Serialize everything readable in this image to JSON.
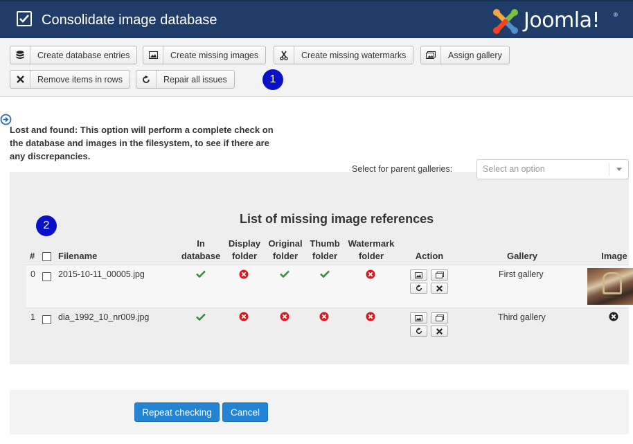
{
  "header": {
    "title": "Consolidate image database",
    "logo_text": "Joomla!"
  },
  "toolbar": {
    "buttons": [
      {
        "label": "Create database entries",
        "icon": "database-icon"
      },
      {
        "label": "Create missing images",
        "icon": "image-icon"
      },
      {
        "label": "Create missing watermarks",
        "icon": "scissors-icon"
      },
      {
        "label": "Assign gallery",
        "icon": "gallery-icon"
      },
      {
        "label": "Remove items in rows",
        "icon": "close-icon"
      },
      {
        "label": "Repair all issues",
        "icon": "refresh-icon"
      }
    ],
    "marker": "1"
  },
  "info": {
    "text": "Lost and found: This option will perform a complete check on the database and images in the filesystem, to see if there are any discrepancies."
  },
  "filter": {
    "label": "Select for parent galleries:",
    "placeholder": "Select an option"
  },
  "list": {
    "title": "List of missing image references",
    "marker": "2",
    "columns": {
      "num": "#",
      "filename": "Filename",
      "in_database": [
        "In",
        "database"
      ],
      "display_folder": [
        "Display",
        "folder"
      ],
      "original_folder": [
        "Original",
        "folder"
      ],
      "thumb_folder": [
        "Thumb",
        "folder"
      ],
      "watermark_folder": [
        "Watermark",
        "folder"
      ],
      "action": "Action",
      "gallery": "Gallery",
      "image": "Image"
    },
    "rows": [
      {
        "num": "0",
        "filename": "2015-10-11_00005.jpg",
        "in_database": true,
        "display_folder": false,
        "original_folder": true,
        "thumb_folder": true,
        "watermark_folder": false,
        "gallery": "First gallery",
        "image": "thumbnail"
      },
      {
        "num": "1",
        "filename": "dia_1992_10_nr009.jpg",
        "in_database": true,
        "display_folder": false,
        "original_folder": false,
        "thumb_folder": false,
        "watermark_folder": false,
        "gallery": "Third gallery",
        "image": "missing-icon"
      }
    ]
  },
  "footer": {
    "repeat_label": "Repeat checking",
    "cancel_label": "Cancel"
  },
  "colors": {
    "header_bg": "#1f3d68",
    "ok": "#3a8c3a",
    "error": "#e0151d",
    "primary": "#2384d3",
    "marker": "#0a12c8"
  }
}
